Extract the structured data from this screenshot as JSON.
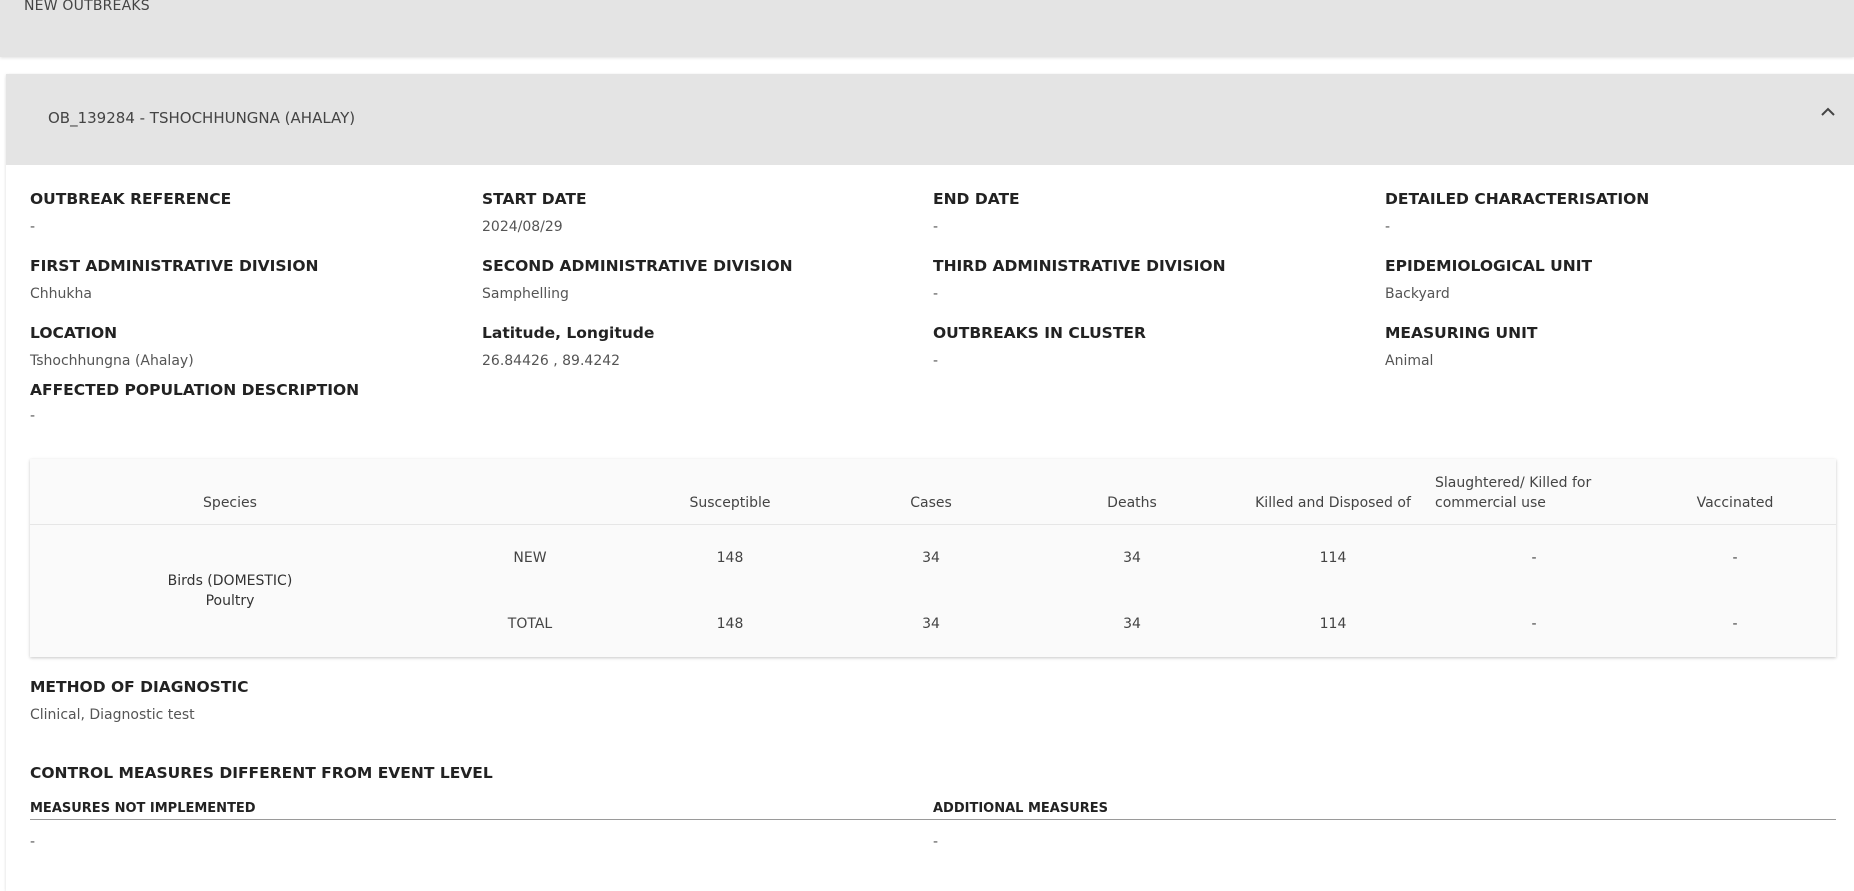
{
  "top_bar": {
    "title": "NEW OUTBREAKS"
  },
  "outbreak": {
    "header": "OB_139284 - TSHOCHHUNGNA (AHALAY)",
    "fields": {
      "outbreak_reference": {
        "label": "OUTBREAK REFERENCE",
        "value": "-"
      },
      "start_date": {
        "label": "START DATE",
        "value": "2024/08/29"
      },
      "end_date": {
        "label": "END DATE",
        "value": "-"
      },
      "detailed_characterisation": {
        "label": "DETAILED CHARACTERISATION",
        "value": "-"
      },
      "first_admin": {
        "label": "FIRST ADMINISTRATIVE DIVISION",
        "value": "Chhukha"
      },
      "second_admin": {
        "label": "SECOND ADMINISTRATIVE DIVISION",
        "value": "Samphelling"
      },
      "third_admin": {
        "label": "THIRD ADMINISTRATIVE DIVISION",
        "value": "-"
      },
      "epi_unit": {
        "label": "EPIDEMIOLOGICAL UNIT",
        "value": "Backyard"
      },
      "location": {
        "label": "LOCATION",
        "value": "Tshochhungna (Ahalay)"
      },
      "lat_long": {
        "label": "Latitude, Longitude",
        "value": "26.84426 , 89.4242"
      },
      "outbreaks_in_cluster": {
        "label": "OUTBREAKS IN CLUSTER",
        "value": "-"
      },
      "measuring_unit": {
        "label": "MEASURING UNIT",
        "value": "Animal"
      },
      "affected_population": {
        "label": "AFFECTED POPULATION DESCRIPTION",
        "value": "-"
      }
    },
    "table": {
      "headers": {
        "species": "Species",
        "susceptible": "Susceptible",
        "cases": "Cases",
        "deaths": "Deaths",
        "killed_disposed": "Killed and Disposed of",
        "slaughtered_line1": "Slaughtered/ Killed for",
        "slaughtered_line2": "commercial use",
        "vaccinated": "Vaccinated"
      },
      "species_line1": "Birds (DOMESTIC)",
      "species_line2": "Poultry",
      "rows": [
        {
          "type": "NEW",
          "susceptible": "148",
          "cases": "34",
          "deaths": "34",
          "killed_disposed": "114",
          "slaughtered": "-",
          "vaccinated": "-"
        },
        {
          "type": "TOTAL",
          "susceptible": "148",
          "cases": "34",
          "deaths": "34",
          "killed_disposed": "114",
          "slaughtered": "-",
          "vaccinated": "-"
        }
      ]
    },
    "method_of_diagnostic": {
      "label": "METHOD OF DIAGNOSTIC",
      "value": "Clinical, Diagnostic test"
    },
    "control_measures": {
      "title": "CONTROL MEASURES DIFFERENT FROM EVENT LEVEL",
      "not_implemented": {
        "label": "MEASURES NOT IMPLEMENTED",
        "value": "-"
      },
      "additional": {
        "label": "ADDITIONAL MEASURES",
        "value": "-"
      }
    }
  }
}
